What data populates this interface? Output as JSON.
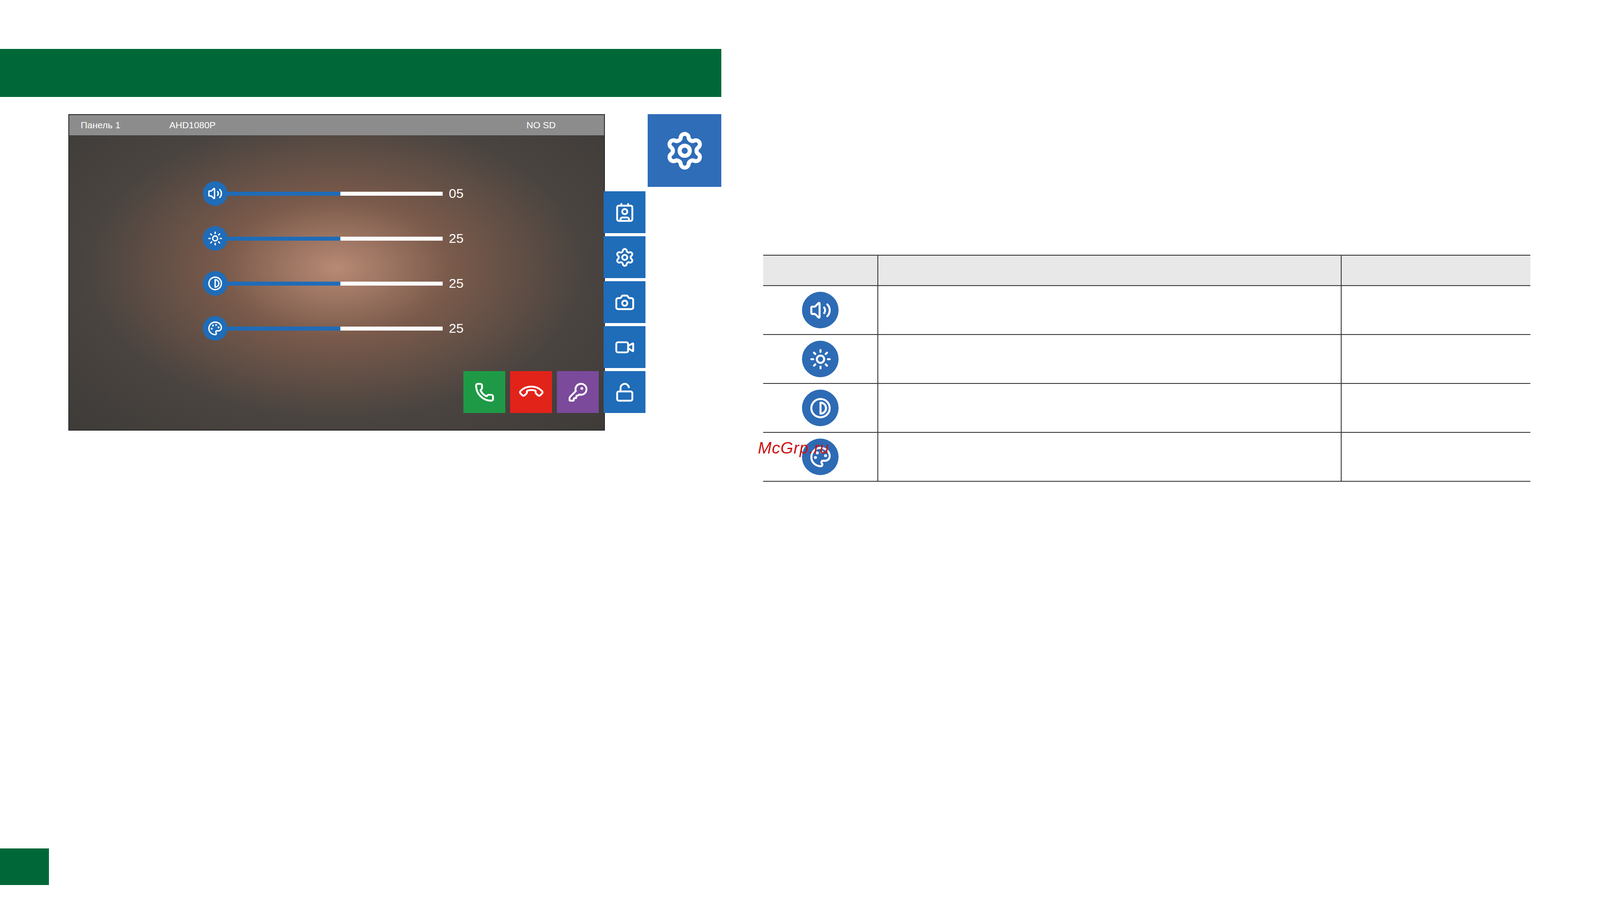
{
  "device_screen": {
    "status_bar": {
      "panel": "Панель 1",
      "video": "AHD1080P",
      "storage": "NO SD"
    },
    "sliders": [
      {
        "kind": "volume",
        "level": 0.55,
        "reading": "05"
      },
      {
        "kind": "brightness",
        "level": 0.55,
        "reading": "25"
      },
      {
        "kind": "contrast",
        "level": 0.55,
        "reading": "25"
      },
      {
        "kind": "color",
        "level": 0.55,
        "reading": "25"
      }
    ],
    "side_buttons": [
      {
        "kind": "contacts",
        "color": "#1f6cb8"
      },
      {
        "kind": "settings",
        "color": "#1f6cb8"
      },
      {
        "kind": "snapshot",
        "color": "#1f6cb8"
      },
      {
        "kind": "record",
        "color": "#1f6cb8"
      }
    ],
    "call_buttons": [
      {
        "kind": "answer",
        "color": "#1e9a46"
      },
      {
        "kind": "hangup",
        "color": "#e2231a"
      },
      {
        "kind": "key",
        "color": "#7b4a9b"
      },
      {
        "kind": "unlock",
        "color": "#1f6cb8"
      }
    ]
  },
  "table": {
    "columns": [
      "",
      "",
      ""
    ],
    "rows": [
      {
        "kind": "volume",
        "description": "",
        "value": ""
      },
      {
        "kind": "brightness",
        "description": "",
        "value": ""
      },
      {
        "kind": "contrast",
        "description": "",
        "value": ""
      },
      {
        "kind": "color",
        "description": "",
        "value": ""
      }
    ]
  },
  "watermark": "McGrp.ru"
}
